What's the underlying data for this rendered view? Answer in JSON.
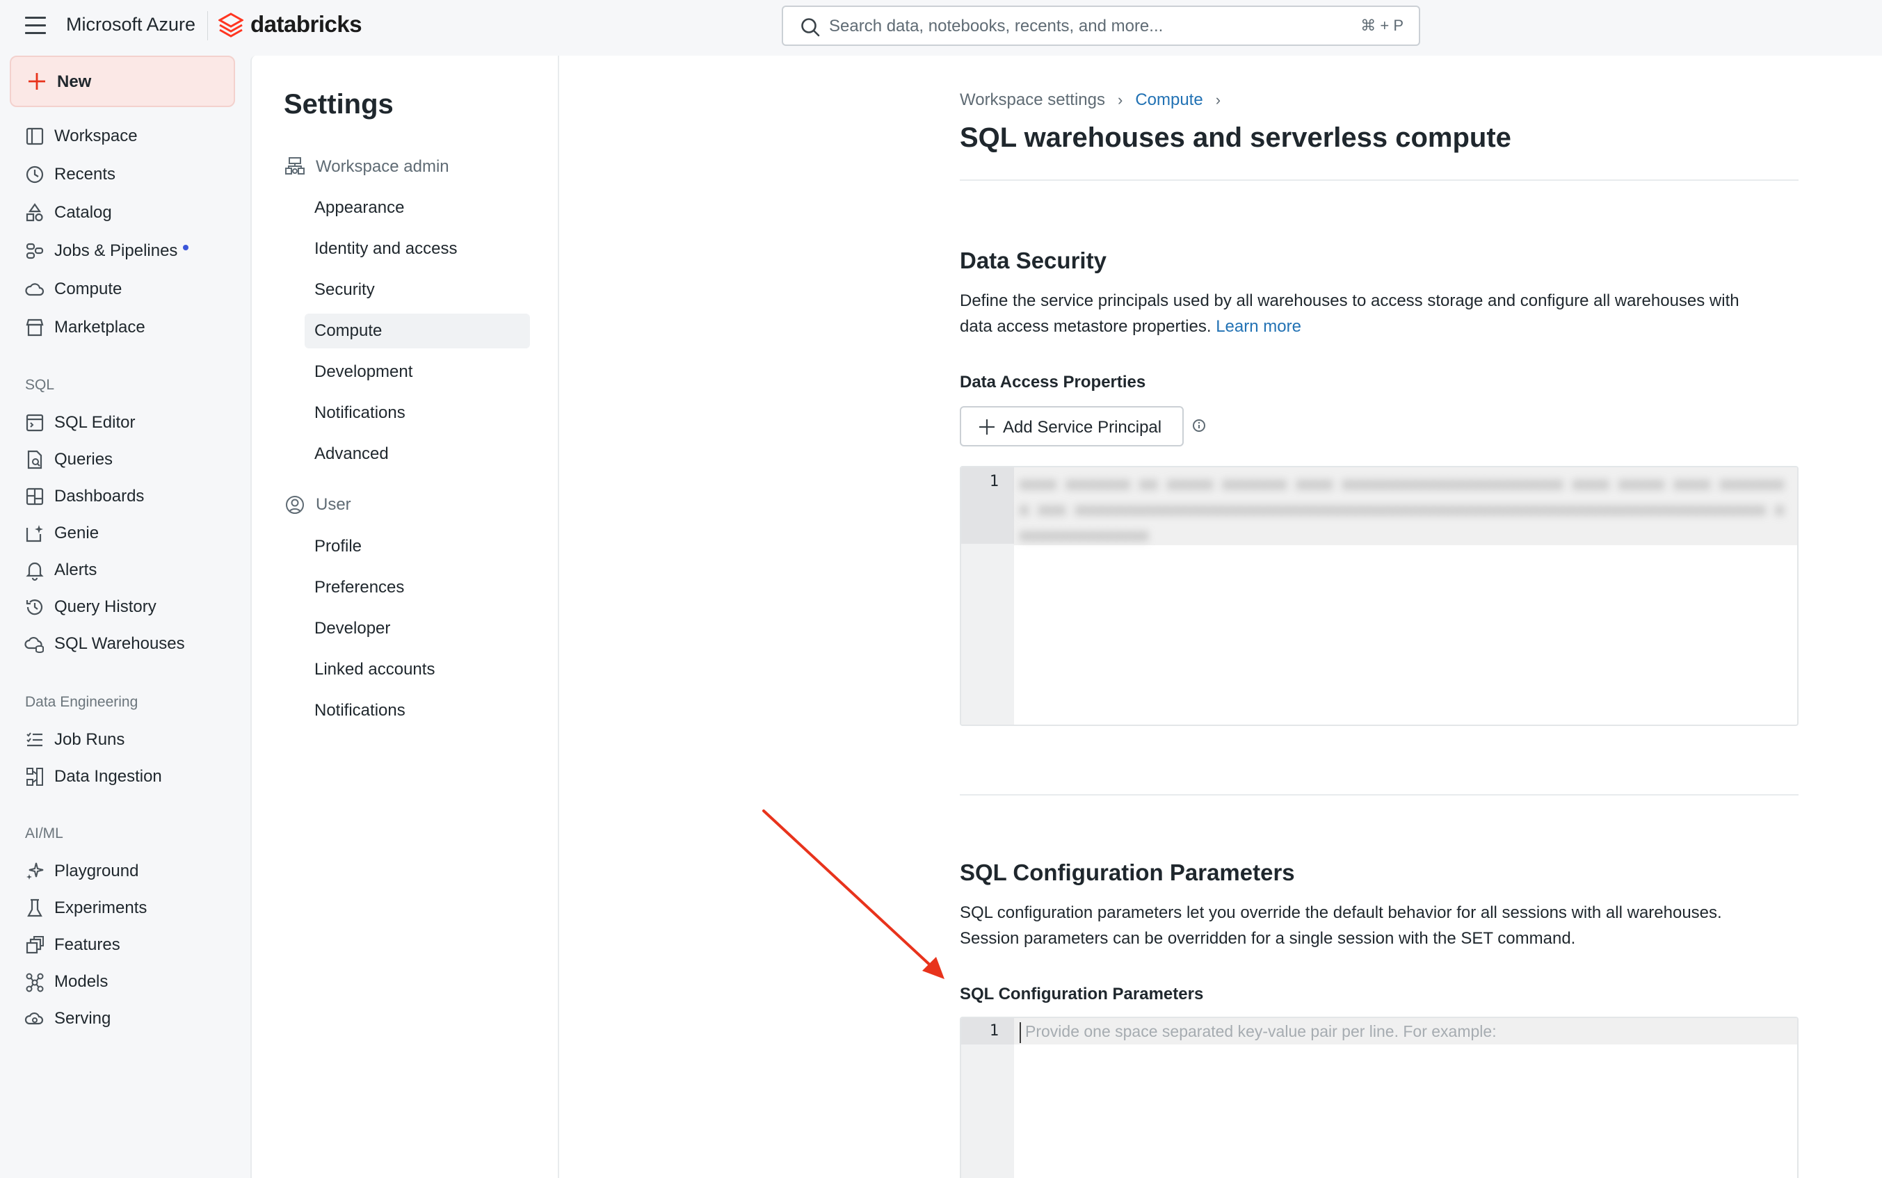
{
  "topbar": {
    "product": "Microsoft Azure",
    "brand": "databricks",
    "search_placeholder": "Search data, notebooks, recents, and more...",
    "search_shortcut": "⌘ + P"
  },
  "leftnav": {
    "new_label": "New",
    "items": [
      {
        "label": "Workspace",
        "icon": "workspace-icon"
      },
      {
        "label": "Recents",
        "icon": "clock-icon"
      },
      {
        "label": "Catalog",
        "icon": "catalog-icon"
      },
      {
        "label": "Jobs & Pipelines",
        "icon": "jobs-icon"
      },
      {
        "label": "Compute",
        "icon": "cloud-icon"
      },
      {
        "label": "Marketplace",
        "icon": "store-icon"
      }
    ],
    "sql_section": "SQL",
    "sql_items": [
      {
        "label": "SQL Editor",
        "icon": "editor-icon"
      },
      {
        "label": "Queries",
        "icon": "query-icon"
      },
      {
        "label": "Dashboards",
        "icon": "dashboard-icon"
      },
      {
        "label": "Genie",
        "icon": "genie-icon"
      },
      {
        "label": "Alerts",
        "icon": "bell-icon"
      },
      {
        "label": "Query History",
        "icon": "history-icon"
      },
      {
        "label": "SQL Warehouses",
        "icon": "warehouse-icon"
      }
    ],
    "de_section": "Data Engineering",
    "de_items": [
      {
        "label": "Job Runs",
        "icon": "list-check-icon"
      },
      {
        "label": "Data Ingestion",
        "icon": "ingestion-icon"
      }
    ],
    "ml_section": "AI/ML",
    "ml_items": [
      {
        "label": "Playground",
        "icon": "sparkle-icon"
      },
      {
        "label": "Experiments",
        "icon": "flask-icon"
      },
      {
        "label": "Features",
        "icon": "features-icon"
      },
      {
        "label": "Models",
        "icon": "models-icon"
      },
      {
        "label": "Serving",
        "icon": "serving-icon"
      }
    ]
  },
  "settings": {
    "title": "Settings",
    "admin_group": "Workspace admin",
    "admin_items": [
      "Appearance",
      "Identity and access",
      "Security",
      "Compute",
      "Development",
      "Notifications",
      "Advanced"
    ],
    "active_item": "Compute",
    "user_group": "User",
    "user_items": [
      "Profile",
      "Preferences",
      "Developer",
      "Linked accounts",
      "Notifications"
    ]
  },
  "main": {
    "breadcrumb": [
      "Workspace settings",
      "Compute"
    ],
    "title": "SQL warehouses and serverless compute",
    "data_security": {
      "title": "Data Security",
      "desc_line1": "Define the service principals used by all warehouses to access storage and configure all warehouses with",
      "desc_line2": "data access metastore properties.",
      "learn_more": "Learn more",
      "field_label": "Data Access Properties",
      "add_button": "Add Service Principal",
      "editor_line_no": "1"
    },
    "sql_config": {
      "title": "SQL Configuration Parameters",
      "desc_line1": "SQL configuration parameters let you override the default behavior for all sessions with all warehouses.",
      "desc_line2": "Session parameters can be overridden for a single session with the SET command.",
      "field_label": "SQL Configuration Parameters",
      "editor_line_no": "1",
      "editor_placeholder": "Provide one space separated key-value pair per line. For example:"
    }
  },
  "colors": {
    "accent_link": "#2272b4",
    "new_button_bg": "#fbe8e6",
    "arrow": "#e8331c",
    "brand_red": "#ff3621"
  }
}
